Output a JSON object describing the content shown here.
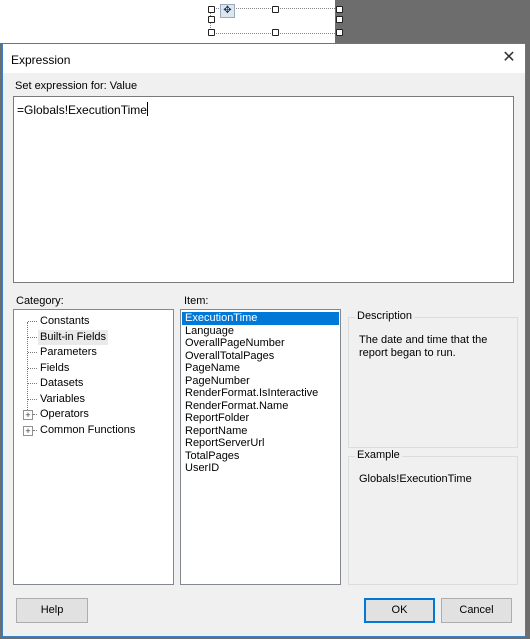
{
  "dialog": {
    "title": "Expression",
    "close_icon": "close-icon",
    "set_expression_label": "Set expression for: Value",
    "expression_value": "=Globals!ExecutionTime"
  },
  "category": {
    "label": "Category:",
    "items": [
      {
        "label": "Constants",
        "expandable": false,
        "highlighted": false
      },
      {
        "label": "Built-in Fields",
        "expandable": false,
        "highlighted": true
      },
      {
        "label": "Parameters",
        "expandable": false,
        "highlighted": false
      },
      {
        "label": "Fields",
        "expandable": false,
        "highlighted": false
      },
      {
        "label": "Datasets",
        "expandable": false,
        "highlighted": false
      },
      {
        "label": "Variables",
        "expandable": false,
        "highlighted": false
      },
      {
        "label": "Operators",
        "expandable": true,
        "highlighted": false
      },
      {
        "label": "Common Functions",
        "expandable": true,
        "highlighted": false
      }
    ]
  },
  "item": {
    "label": "Item:",
    "selected": "ExecutionTime",
    "items": [
      "ExecutionTime",
      "Language",
      "OverallPageNumber",
      "OverallTotalPages",
      "PageName",
      "PageNumber",
      "RenderFormat.IsInteractive",
      "RenderFormat.Name",
      "ReportFolder",
      "ReportName",
      "ReportServerUrl",
      "TotalPages",
      "UserID"
    ]
  },
  "description": {
    "label": "Description",
    "text": "The date and time that the report began to run."
  },
  "example": {
    "label": "Example",
    "text": "Globals!ExecutionTime"
  },
  "buttons": {
    "help": "Help",
    "ok": "OK",
    "cancel": "Cancel"
  },
  "colors": {
    "accent": "#0078d7",
    "dialog_bg": "#f0f0f0",
    "backdrop": "#6d6d6d"
  }
}
